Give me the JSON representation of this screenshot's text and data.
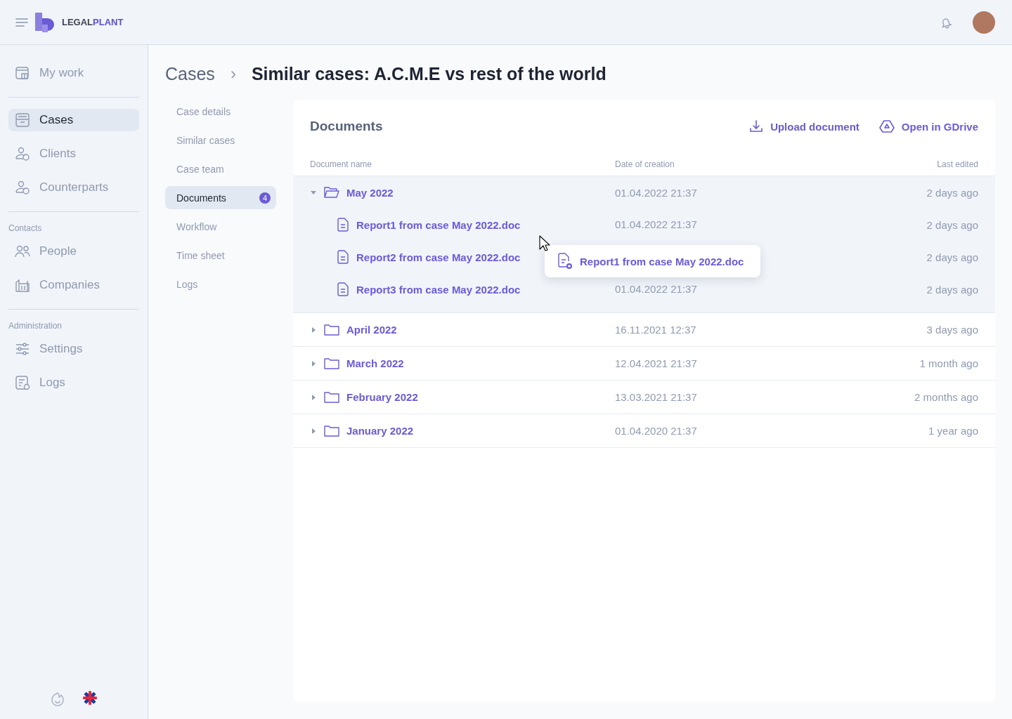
{
  "header": {
    "logo": {
      "part_1": "LEGAL",
      "part_2": "PLANT"
    }
  },
  "sidebar": {
    "groups": [
      {
        "items": [
          {
            "label": "My work",
            "kind": "calendar",
            "selected": false
          }
        ]
      },
      {
        "items": [
          {
            "label": "Cases",
            "kind": "archive",
            "selected": true
          },
          {
            "label": "Clients",
            "kind": "user",
            "selected": false
          },
          {
            "label": "Counterparts",
            "kind": "user",
            "selected": false
          }
        ]
      },
      {
        "title": "Contacts",
        "items": [
          {
            "label": "People",
            "kind": "people",
            "selected": false
          },
          {
            "label": "Companies",
            "kind": "building",
            "selected": false
          }
        ]
      },
      {
        "title": "Administration",
        "items": [
          {
            "label": "Settings",
            "kind": "sliders",
            "selected": false
          },
          {
            "label": "Logs",
            "kind": "logs",
            "selected": false
          }
        ]
      }
    ]
  },
  "breadcrumb": {
    "parent": "Cases",
    "separator": "›",
    "title": "Similar cases: A.C.M.E vs rest of the world"
  },
  "subnav": [
    {
      "label": "Case details",
      "selected": false
    },
    {
      "label": "Similar cases",
      "selected": false
    },
    {
      "label": "Case team",
      "selected": false
    },
    {
      "label": "Documents",
      "selected": true,
      "badge": "4"
    },
    {
      "label": "Workflow",
      "selected": false
    },
    {
      "label": "Time sheet",
      "selected": false
    },
    {
      "label": "Logs",
      "selected": false
    }
  ],
  "documents": {
    "title": "Documents",
    "actions": [
      {
        "label": "Upload document",
        "kind": "upload"
      },
      {
        "label": "Open in GDrive",
        "kind": "drive"
      }
    ],
    "columns": [
      "Document name",
      "Date of creation",
      "Last edited"
    ],
    "rows": [
      {
        "name": "May 2022",
        "created": "01.04.2022 21:37",
        "edited": "2 days ago",
        "expanded": true,
        "children": [
          {
            "name": "Report1 from case May 2022.doc",
            "created": "01.04.2022 21:37",
            "edited": "2 days ago"
          },
          {
            "name": "Report2 from case May 2022.doc",
            "edited": "2 days ago"
          },
          {
            "name": "Report3 from case May 2022.doc",
            "created": "01.04.2022 21:37",
            "edited": "2 days ago"
          }
        ]
      },
      {
        "name": "April 2022",
        "created": "16.11.2021 12:37",
        "edited": "3 days ago",
        "expanded": false
      },
      {
        "name": "March 2022",
        "created": "12.04.2021 21:37",
        "edited": "1 month ago",
        "expanded": false
      },
      {
        "name": "February 2022",
        "created": "13.03.2021 21:37",
        "edited": "2 months ago",
        "expanded": false
      },
      {
        "name": "January 2022",
        "created": "01.04.2020 21:37",
        "edited": "1 year ago",
        "expanded": false
      }
    ],
    "drag_item": {
      "name": "Report1 from case May 2022.doc"
    }
  }
}
